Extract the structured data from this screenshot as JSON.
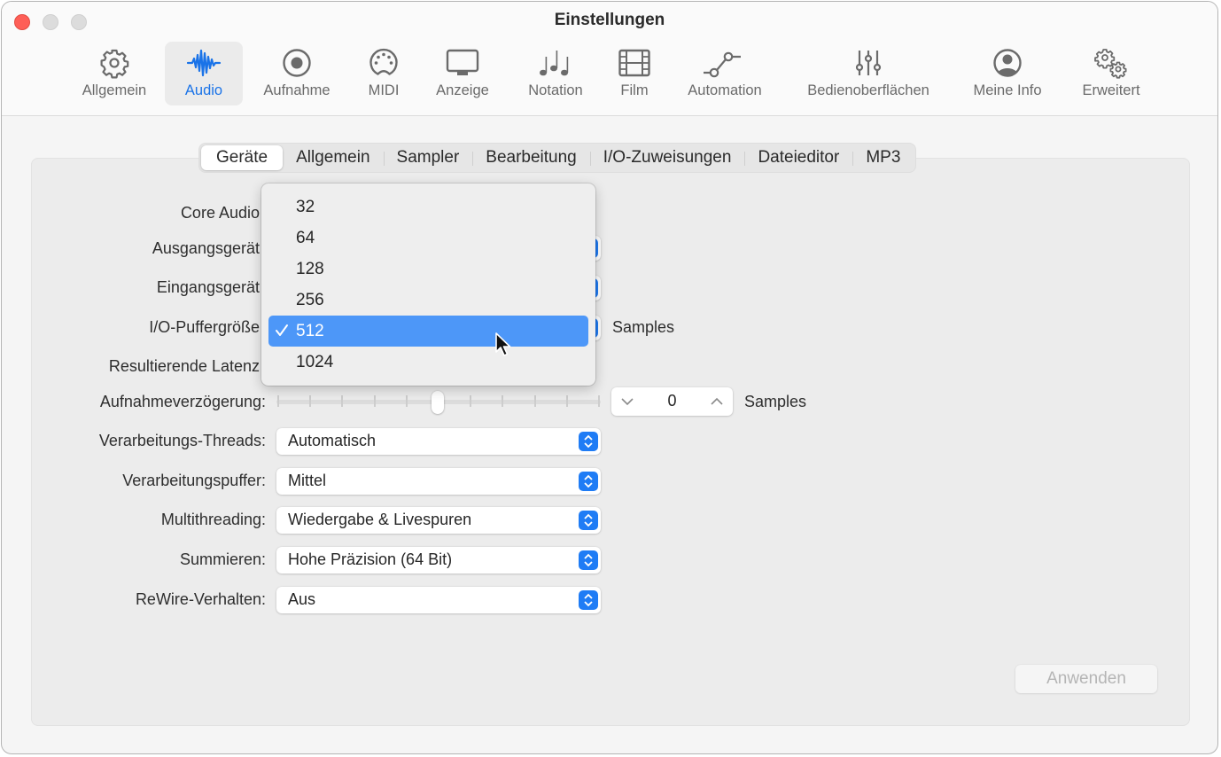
{
  "window": {
    "title": "Einstellungen"
  },
  "toolbar": {
    "items": [
      {
        "id": "allgemein",
        "label": "Allgemein",
        "icon": "gear-icon",
        "active": false
      },
      {
        "id": "audio",
        "label": "Audio",
        "icon": "waveform-icon",
        "active": true
      },
      {
        "id": "aufnahme",
        "label": "Aufnahme",
        "icon": "record-icon",
        "active": false
      },
      {
        "id": "midi",
        "label": "MIDI",
        "icon": "midi-port-icon",
        "active": false
      },
      {
        "id": "anzeige",
        "label": "Anzeige",
        "icon": "display-icon",
        "active": false
      },
      {
        "id": "notation",
        "label": "Notation",
        "icon": "music-notes-icon",
        "active": false
      },
      {
        "id": "film",
        "label": "Film",
        "icon": "film-icon",
        "active": false
      },
      {
        "id": "automation",
        "label": "Automation",
        "icon": "automation-curve-icon",
        "active": false
      },
      {
        "id": "bedienoberflaechen",
        "label": "Bedienoberflächen",
        "icon": "sliders-icon",
        "active": false
      },
      {
        "id": "meine-info",
        "label": "Meine Info",
        "icon": "person-circle-icon",
        "active": false
      },
      {
        "id": "erweitert",
        "label": "Erweitert",
        "icon": "gears-icon",
        "active": false
      }
    ]
  },
  "tabs": [
    {
      "label": "Geräte",
      "active": true
    },
    {
      "label": "Allgemein",
      "active": false
    },
    {
      "label": "Sampler",
      "active": false
    },
    {
      "label": "Bearbeitung",
      "active": false
    },
    {
      "label": "I/O-Zuweisungen",
      "active": false
    },
    {
      "label": "Dateieditor",
      "active": false
    },
    {
      "label": "MP3",
      "active": false
    }
  ],
  "form": {
    "core_audio_label": "Core Audio",
    "output_device_label": "Ausgangsgerät",
    "input_device_label": "Eingangsgerät",
    "buffer_size_label": "I/O-Puffergröße",
    "buffer_size_unit": "Samples",
    "latency_label": "Resultierende Latenz",
    "recording_delay": {
      "label": "Aufnahmeverzögerung:",
      "value": "0",
      "unit": "Samples",
      "slider_position": 0.5
    },
    "processing_threads": {
      "label": "Verarbeitungs-Threads:",
      "value": "Automatisch"
    },
    "process_buffer": {
      "label": "Verarbeitungspuffer:",
      "value": "Mittel"
    },
    "multithreading": {
      "label": "Multithreading:",
      "value": "Wiedergabe & Livespuren"
    },
    "summing": {
      "label": "Summieren:",
      "value": "Hohe Präzision (64 Bit)"
    },
    "rewire": {
      "label": "ReWire-Verhalten:",
      "value": "Aus"
    }
  },
  "buffer_menu": {
    "options": [
      "32",
      "64",
      "128",
      "256",
      "512",
      "1024"
    ],
    "selected": "512",
    "checkmark": "✓"
  },
  "apply_button": {
    "label": "Anwenden",
    "enabled": false
  },
  "colors": {
    "accent": "#1f7cf5",
    "menu_highlight": "#4d97f8",
    "close_button": "#fe5f57"
  }
}
